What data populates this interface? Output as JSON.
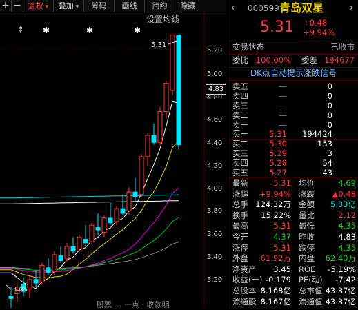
{
  "toolbar": {
    "items": [
      {
        "label": "+",
        "type": "icon"
      },
      {
        "label": "−",
        "type": "icon"
      },
      {
        "label": "复权",
        "color": "red",
        "dropdown": true
      },
      {
        "label": "叠加",
        "dropdown": true
      },
      {
        "label": "筹码"
      },
      {
        "label": "画线"
      },
      {
        "label": "简约"
      },
      {
        "label": "隐藏"
      }
    ]
  },
  "chart": {
    "settings_link": "设置均线",
    "high_label": "5.31",
    "low_label": "3.05",
    "yticks": [
      "5.20",
      "5.00",
      "4.80",
      "4.60",
      "4.40",
      "4.20",
      "4.00",
      "3.80",
      "3.60",
      "3.40",
      "3.20"
    ],
    "current_price": "4.83",
    "bottom_text": "股票 … 一点 · 收款明"
  },
  "chart_data": {
    "type": "candlestick",
    "ylim": [
      3.0,
      5.4
    ],
    "candles": [
      [
        3.1,
        3.18,
        3.0,
        3.08
      ],
      [
        3.12,
        3.2,
        3.05,
        3.15
      ],
      [
        3.2,
        3.26,
        3.1,
        3.14
      ],
      [
        3.16,
        3.28,
        3.08,
        3.24
      ],
      [
        3.24,
        3.32,
        3.18,
        3.21
      ],
      [
        3.22,
        3.38,
        3.2,
        3.36
      ],
      [
        3.34,
        3.42,
        3.28,
        3.3
      ],
      [
        3.31,
        3.48,
        3.28,
        3.45
      ],
      [
        3.44,
        3.52,
        3.38,
        3.4
      ],
      [
        3.42,
        3.55,
        3.4,
        3.52
      ],
      [
        3.52,
        3.6,
        3.46,
        3.48
      ],
      [
        3.5,
        3.62,
        3.48,
        3.6
      ],
      [
        3.58,
        3.7,
        3.52,
        3.55
      ],
      [
        3.56,
        3.72,
        3.54,
        3.7
      ],
      [
        3.68,
        3.8,
        3.62,
        3.66
      ],
      [
        3.64,
        3.78,
        3.6,
        3.76
      ],
      [
        3.76,
        3.9,
        3.7,
        3.72
      ],
      [
        3.73,
        3.86,
        3.7,
        3.84
      ],
      [
        3.84,
        3.96,
        3.78,
        3.8
      ],
      [
        3.82,
        4.02,
        3.78,
        3.98
      ],
      [
        3.98,
        4.1,
        3.9,
        3.94
      ],
      [
        3.96,
        4.3,
        3.94,
        4.28
      ],
      [
        4.28,
        4.48,
        4.2,
        4.46
      ],
      [
        4.46,
        4.56,
        4.38,
        4.4
      ],
      [
        4.4,
        4.7,
        4.38,
        4.66
      ],
      [
        4.66,
        4.92,
        4.6,
        4.9
      ],
      [
        4.84,
        5.31,
        4.8,
        5.31
      ],
      [
        5.31,
        5.31,
        4.34,
        4.38
      ]
    ],
    "ma_lines": [
      {
        "name": "MA5",
        "color": "#ffffff"
      },
      {
        "name": "MA10",
        "color": "#e8d200"
      },
      {
        "name": "MA20",
        "color": "#e000e0"
      },
      {
        "name": "MA30",
        "color": "#00c000"
      },
      {
        "name": "MA60",
        "color": "#8a8a8a"
      },
      {
        "name": "MA120",
        "color": "#ffffff"
      },
      {
        "name": "MA250",
        "color": "#00d8d8"
      }
    ]
  },
  "quote": {
    "code": "000599",
    "name": "青岛双星",
    "price": "5.31",
    "change": "+0.48",
    "change_pct": "+9.94%",
    "status_label": "交易状态",
    "status_value": "已收市",
    "weibi_label": "委比",
    "weibi_value": "100.00%",
    "weicha_label": "委差",
    "weicha_value": "194677",
    "dk_banner": "DK点自动提示涨跌信号"
  },
  "order_book": {
    "asks": [
      {
        "label": "卖五",
        "price": "—",
        "vol": "0"
      },
      {
        "label": "卖四",
        "price": "—",
        "vol": "0"
      },
      {
        "label": "卖三",
        "price": "—",
        "vol": "0"
      },
      {
        "label": "卖二",
        "price": "—",
        "vol": "0"
      },
      {
        "label": "卖一",
        "price": "—",
        "vol": "0"
      }
    ],
    "bids": [
      {
        "label": "买一",
        "price": "5.31",
        "vol": "194424"
      },
      {
        "label": "买二",
        "price": "5.30",
        "vol": "153"
      },
      {
        "label": "买三",
        "price": "5.29",
        "vol": "3"
      },
      {
        "label": "买四",
        "price": "5.28",
        "vol": "54"
      },
      {
        "label": "买五",
        "price": "5.27",
        "vol": "43"
      }
    ]
  },
  "stats": [
    {
      "l1": "最新",
      "v1": "5.31",
      "c1": "red",
      "l2": "均价",
      "v2": "4.69",
      "c2": "green"
    },
    {
      "l1": "涨幅",
      "v1": "+9.94%",
      "c1": "red",
      "l2": "涨跌",
      "v2": "▲0.48",
      "c2": "red"
    },
    {
      "l1": "总手",
      "v1": "124.32万",
      "c1": "white",
      "l2": "金额",
      "v2": "5.83亿",
      "c2": "cyan"
    },
    {
      "l1": "换手",
      "v1": "15.22%",
      "c1": "white",
      "l2": "量比",
      "v2": "2.12",
      "c2": "red"
    },
    {
      "l1": "最高",
      "v1": "5.31",
      "c1": "red",
      "l2": "最低",
      "v2": "4.35",
      "c2": "green"
    },
    {
      "l1": "今开",
      "v1": "4.37",
      "c1": "green",
      "l2": "昨收",
      "v2": "4.83",
      "c2": "white"
    },
    {
      "l1": "涨停",
      "v1": "5.31",
      "c1": "red",
      "l2": "跌停",
      "v2": "4.35",
      "c2": "green"
    },
    {
      "l1": "外盘",
      "v1": "61.92万",
      "c1": "red",
      "l2": "内盘",
      "v2": "62.40万",
      "c2": "green"
    },
    {
      "l1": "净资产",
      "v1": "3.45",
      "c1": "white",
      "l2": "ROE",
      "v2": "-5.19%",
      "c2": "white"
    },
    {
      "l1": "收益(一)",
      "v1": "-0.179",
      "c1": "white",
      "l2": "PE(动)",
      "v2": "-7.42",
      "c2": "white"
    },
    {
      "l1": "总股本",
      "v1": "8.168亿",
      "c1": "white",
      "l2": "总市值",
      "v2": "43.37亿",
      "c2": "white"
    },
    {
      "l1": "流通股",
      "v1": "8.167亿",
      "c1": "white",
      "l2": "流通值",
      "v2": "43.37亿",
      "c2": "white"
    }
  ]
}
